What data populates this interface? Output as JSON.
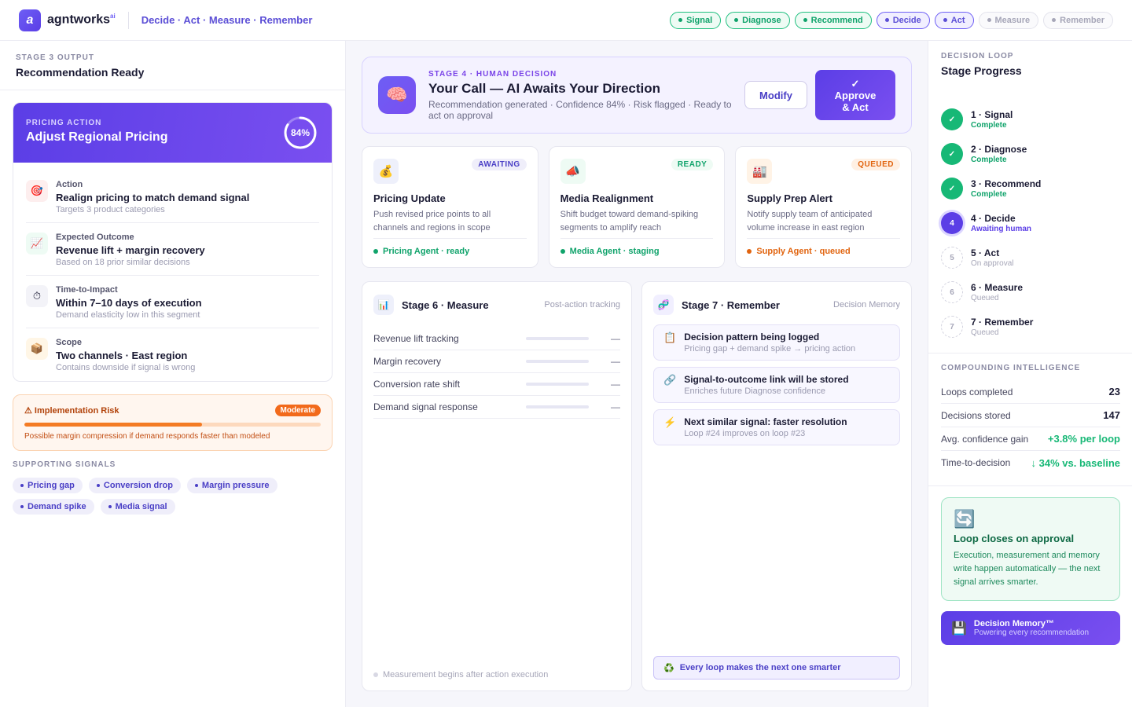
{
  "brand": {
    "mark": "a",
    "name": "agntworks",
    "sup": "ai",
    "tagline": "Decide · Act · Measure · Remember"
  },
  "pipeline": [
    {
      "label": "Signal",
      "state": "done"
    },
    {
      "label": "Diagnose",
      "state": "done"
    },
    {
      "label": "Recommend",
      "state": "done"
    },
    {
      "label": "Decide",
      "state": "active"
    },
    {
      "label": "Act",
      "state": "active"
    },
    {
      "label": "Measure",
      "state": "todo"
    },
    {
      "label": "Remember",
      "state": "todo"
    }
  ],
  "left": {
    "eyebrow": "STAGE 3 OUTPUT",
    "title": "Recommendation Ready",
    "card": {
      "eyebrow": "PRICING ACTION",
      "title": "Adjust Regional Pricing",
      "confidence_label": "84%",
      "confidence": 0.84,
      "items": [
        {
          "label": "Action",
          "value": "Realign pricing to match demand signal",
          "sub": "Targets 3 product categories"
        },
        {
          "label": "Expected Outcome",
          "value": "Revenue lift + margin recovery",
          "sub": "Based on 18 prior similar decisions"
        },
        {
          "label": "Time-to-Impact",
          "value": "Within 7–10 days of execution",
          "sub": "Demand elasticity low in this segment"
        },
        {
          "label": "Scope",
          "value": "Two channels · East region",
          "sub": "Contains downside if signal is wrong"
        }
      ]
    },
    "risk": {
      "title": "⚠ Implementation Risk",
      "badge": "Moderate",
      "level": 0.6,
      "text": "Possible margin compression if demand responds faster than modeled"
    },
    "signals_title": "SUPPORTING SIGNALS",
    "signals": [
      "Pricing gap",
      "Conversion drop",
      "Margin pressure",
      "Demand spike",
      "Media signal"
    ]
  },
  "decision": {
    "eyebrow": "STAGE 4 · HUMAN DECISION",
    "title": "Your Call — AI Awaits Your Direction",
    "sub": "Recommendation generated · Confidence 84% · Risk flagged · Ready to act on approval",
    "modify": "Modify",
    "approve_check": "✓",
    "approve_line1": "Approve",
    "approve_line2": "& Act"
  },
  "agents": [
    {
      "badge": "AWAITING",
      "name": "Pricing Update",
      "desc": "Push revised price points to all channels and regions in scope",
      "foot": "Pricing Agent · ready"
    },
    {
      "badge": "READY",
      "name": "Media Realignment",
      "desc": "Shift budget toward demand-spiking segments to amplify reach",
      "foot": "Media Agent · staging"
    },
    {
      "badge": "QUEUED",
      "name": "Supply Prep Alert",
      "desc": "Notify supply team of anticipated volume increase in east region",
      "foot": "Supply Agent · queued"
    }
  ],
  "measure": {
    "title": "Stage 6 · Measure",
    "note": "Post-action tracking",
    "rows": [
      {
        "label": "Revenue lift tracking",
        "value": "—"
      },
      {
        "label": "Margin recovery",
        "value": "—"
      },
      {
        "label": "Conversion rate shift",
        "value": "—"
      },
      {
        "label": "Demand signal response",
        "value": "—"
      }
    ],
    "foot": "Measurement begins after action execution"
  },
  "remember": {
    "title": "Stage 7 · Remember",
    "note": "Decision Memory",
    "items": [
      {
        "title": "Decision pattern being logged",
        "sub": "Pricing gap + demand spike → pricing action"
      },
      {
        "title": "Signal-to-outcome link will be stored",
        "sub": "Enriches future Diagnose confidence"
      },
      {
        "title": "Next similar signal: faster resolution",
        "sub": "Loop #24 improves on loop #23"
      }
    ],
    "foot": "Every loop makes the next one smarter"
  },
  "right": {
    "eyebrow": "DECISION LOOP",
    "title": "Stage Progress",
    "steps": [
      {
        "num": "✓",
        "name": "1 · Signal",
        "status": "Complete",
        "state": "done"
      },
      {
        "num": "✓",
        "name": "2 · Diagnose",
        "status": "Complete",
        "state": "done"
      },
      {
        "num": "✓",
        "name": "3 · Recommend",
        "status": "Complete",
        "state": "done"
      },
      {
        "num": "4",
        "name": "4 · Decide",
        "status": "Awaiting human",
        "state": "active"
      },
      {
        "num": "5",
        "name": "5 · Act",
        "status": "On approval",
        "state": "todo"
      },
      {
        "num": "6",
        "name": "6 · Measure",
        "status": "Queued",
        "state": "todo"
      },
      {
        "num": "7",
        "name": "7 · Remember",
        "status": "Queued",
        "state": "todo"
      }
    ],
    "ci_title": "COMPOUNDING INTELLIGENCE",
    "ci": [
      {
        "label": "Loops completed",
        "value": "23"
      },
      {
        "label": "Decisions stored",
        "value": "147"
      },
      {
        "label": "Avg. confidence gain",
        "value": "+3.8% per loop"
      },
      {
        "label": "Time-to-decision",
        "value": "↓ 34% vs. baseline"
      }
    ],
    "loop_card": {
      "title": "Loop closes on approval",
      "desc": "Execution, measurement and memory write happen automatically — the next signal arrives smarter."
    },
    "memory": {
      "title": "Decision Memory™",
      "sub": "Powering every recommendation"
    }
  },
  "colors": {
    "accent": "#5b3ee6",
    "success": "#17b876",
    "warning": "#f26a1b"
  }
}
